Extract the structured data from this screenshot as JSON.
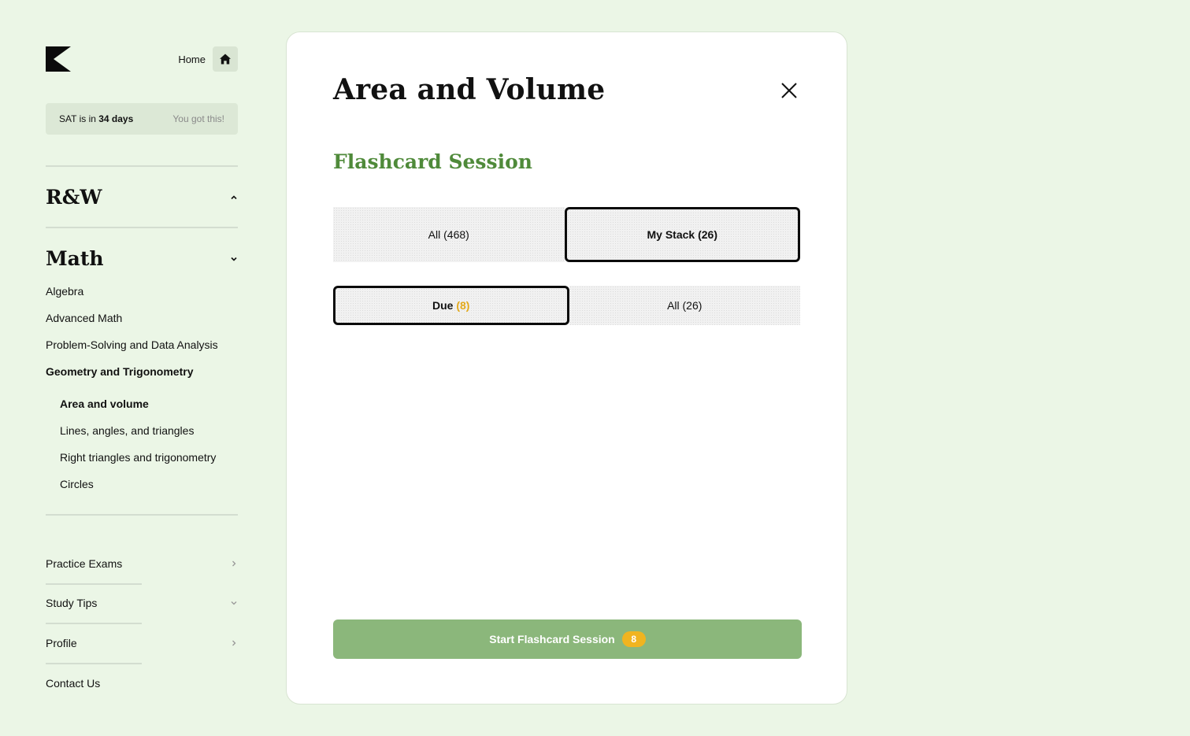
{
  "header": {
    "home_label": "Home"
  },
  "countdown": {
    "prefix": "SAT is in",
    "days": "34 days",
    "cheer": "You got this!"
  },
  "sections": {
    "rw": {
      "title": "R&W"
    },
    "math": {
      "title": "Math",
      "items": [
        {
          "label": "Algebra"
        },
        {
          "label": "Advanced Math"
        },
        {
          "label": "Problem-Solving and Data Analysis"
        },
        {
          "label": "Geometry and Trigonometry"
        }
      ],
      "subitems": [
        {
          "label": "Area and volume"
        },
        {
          "label": "Lines, angles, and triangles"
        },
        {
          "label": "Right triangles and trigonometry"
        },
        {
          "label": "Circles"
        }
      ]
    }
  },
  "footer_nav": [
    {
      "label": "Practice Exams"
    },
    {
      "label": "Study Tips"
    },
    {
      "label": "Profile"
    },
    {
      "label": "Contact Us"
    }
  ],
  "panel": {
    "title": "Area and Volume",
    "session_title": "Flashcard Session",
    "source_options": [
      {
        "label": "All (468)"
      },
      {
        "label": "My Stack (26)"
      }
    ],
    "filter_options": {
      "due_label": "Due",
      "due_count": "(8)",
      "all_label": "All (26)"
    },
    "start_button": {
      "label": "Start Flashcard Session",
      "badge": "8"
    }
  },
  "colors": {
    "background": "#ebf6e6",
    "accent_green": "#4f8a3a",
    "button_green": "#8bb77b",
    "badge_orange": "#f0b420"
  }
}
